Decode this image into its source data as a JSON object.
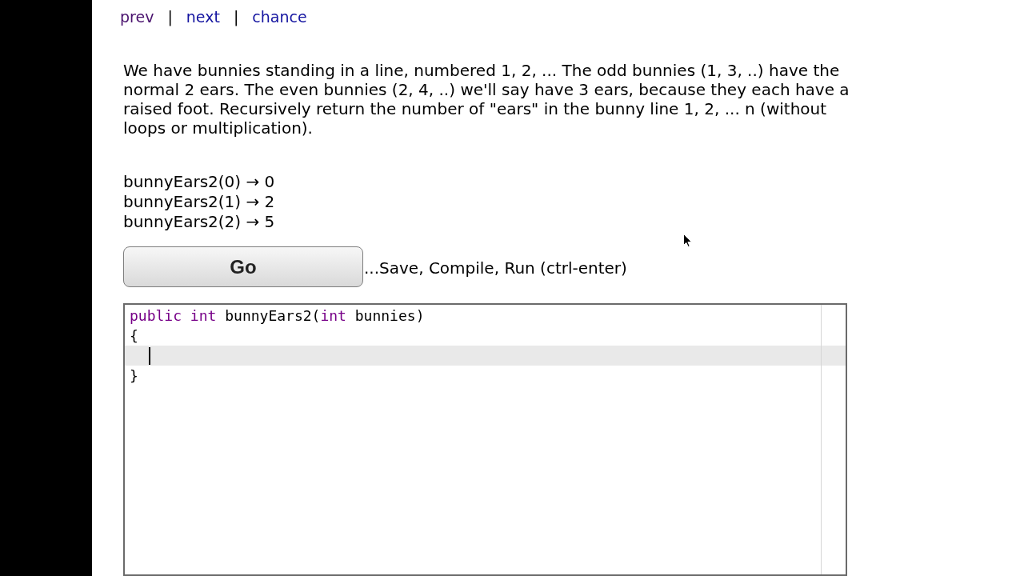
{
  "nav": [
    {
      "kind": "link",
      "label": "prev",
      "visited": true
    },
    {
      "kind": "separator",
      "label": "|"
    },
    {
      "kind": "link",
      "label": "next",
      "visited": false
    },
    {
      "kind": "separator",
      "label": "|"
    },
    {
      "kind": "link",
      "label": "chance",
      "visited": false
    }
  ],
  "description": "We have bunnies standing in a line, numbered 1, 2, ... The odd bunnies (1, 3, ..) have the normal 2 ears. The even bunnies (2, 4, ..) we'll say have 3 ears, because they each have a raised foot. Recursively return the number of \"ears\" in the bunny line 1, 2, ... n (without loops or multiplication).",
  "examples": [
    "bunnyEars2(0) → 0",
    "bunnyEars2(1) → 2",
    "bunnyEars2(2) → 5"
  ],
  "go_button": "Go",
  "go_hint": "...Save, Compile, Run (ctrl-enter)",
  "editor": {
    "lines": [
      {
        "active": false,
        "cursor": false,
        "tokens": [
          {
            "kind": "keyword",
            "text": "public "
          },
          {
            "kind": "keyword",
            "text": "int"
          },
          {
            "kind": "plain",
            "text": " bunnyEars2("
          },
          {
            "kind": "keyword",
            "text": "int"
          },
          {
            "kind": "plain",
            "text": " bunnies)"
          }
        ]
      },
      {
        "active": false,
        "cursor": false,
        "tokens": [
          {
            "kind": "plain",
            "text": "{"
          }
        ]
      },
      {
        "active": true,
        "cursor": true
      },
      {
        "active": false,
        "cursor": false,
        "tokens": [
          {
            "kind": "plain",
            "text": "}"
          }
        ]
      }
    ]
  }
}
